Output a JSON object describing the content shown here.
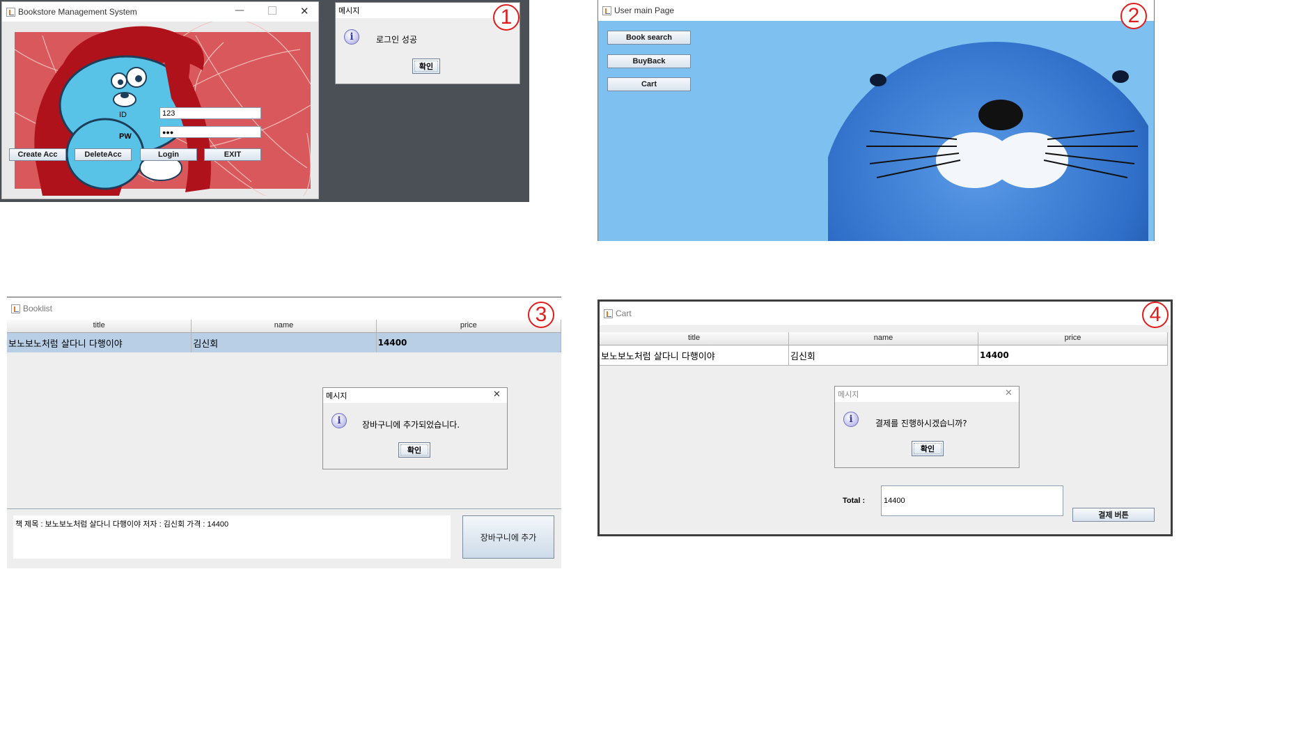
{
  "panel1": {
    "badge": "1",
    "login_window": {
      "title": "Bookstore Management System",
      "id_label": "ID",
      "pw_label": "PW",
      "id_value": "123",
      "pw_value": "●●●",
      "buttons": [
        "Create Acc",
        "DeleteAcc",
        "Login",
        "EXIT"
      ]
    },
    "dialog": {
      "title": "메시지",
      "message": "로그인 성공",
      "ok": "확인"
    }
  },
  "panel2": {
    "badge": "2",
    "title": "User main Page",
    "buttons": [
      "Book search",
      "BuyBack",
      "Cart"
    ]
  },
  "panel3": {
    "badge": "3",
    "title": "Booklist",
    "columns": [
      "title",
      "name",
      "price"
    ],
    "rows": [
      [
        "보노보노처럼 살다니 다행이야",
        "김신회",
        "14400"
      ]
    ],
    "dialog": {
      "title": "메시지",
      "message": "장바구니에 추가되었습니다.",
      "ok": "확인"
    },
    "detail_text": "책 제목 : 보노보노처럼 살다니 다행이야  저자 : 김신회  가격 : 14400",
    "add_button": "장바구니에 추가"
  },
  "panel4": {
    "badge": "4",
    "title": "Cart",
    "columns": [
      "title",
      "name",
      "price"
    ],
    "rows": [
      [
        "보노보노처럼 살다니 다행이야",
        "김신회",
        "14400"
      ]
    ],
    "dialog": {
      "title": "메시지",
      "message": "결제를 진행하시겠습니까?",
      "ok": "확인"
    },
    "total_label": "Total :",
    "total_value": "14400",
    "pay_button": "결제 버튼"
  },
  "colors": {
    "badge_red": "#e21b1b",
    "sky_blue": "#7ec0f0",
    "selected_row": "#b8cfe5",
    "dark_bg": "#4a5055"
  }
}
